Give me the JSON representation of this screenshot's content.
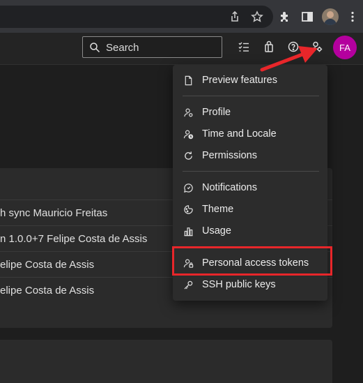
{
  "search": {
    "label": "Search"
  },
  "user": {
    "initials": "FA"
  },
  "menu": {
    "items": [
      {
        "label": "Preview features",
        "icon": "page-icon"
      },
      {
        "label": "Profile",
        "icon": "profile-icon"
      },
      {
        "label": "Time and Locale",
        "icon": "time-locale-icon"
      },
      {
        "label": "Permissions",
        "icon": "refresh-icon"
      },
      {
        "label": "Notifications",
        "icon": "notification-icon"
      },
      {
        "label": "Theme",
        "icon": "theme-icon"
      },
      {
        "label": "Usage",
        "icon": "usage-icon"
      },
      {
        "label": "Personal access tokens",
        "icon": "token-icon"
      },
      {
        "label": "SSH public keys",
        "icon": "key-icon"
      }
    ]
  },
  "list": {
    "rows": [
      {
        "text": "h sync",
        "author": "Mauricio Freitas"
      },
      {
        "text": "n 1.0.0+7",
        "author": "Felipe Costa de Assis"
      },
      {
        "text": "elipe Costa de Assis",
        "author": ""
      },
      {
        "text": "elipe Costa de Assis",
        "author": ""
      }
    ]
  },
  "colors": {
    "avatar": "#b4009e",
    "highlight": "#e8262a",
    "background": "#1e1e1e",
    "menu": "#2c2c2c"
  }
}
